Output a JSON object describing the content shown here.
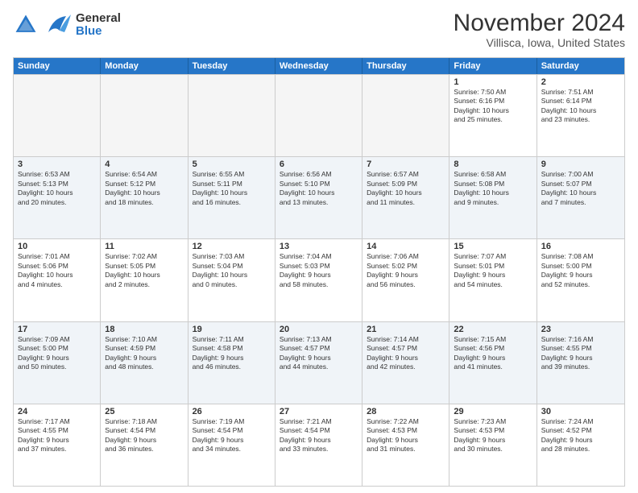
{
  "header": {
    "logo_general": "General",
    "logo_blue": "Blue",
    "month": "November 2024",
    "location": "Villisca, Iowa, United States"
  },
  "days_of_week": [
    "Sunday",
    "Monday",
    "Tuesday",
    "Wednesday",
    "Thursday",
    "Friday",
    "Saturday"
  ],
  "weeks": [
    [
      {
        "day": "",
        "info": "",
        "empty": true
      },
      {
        "day": "",
        "info": "",
        "empty": true
      },
      {
        "day": "",
        "info": "",
        "empty": true
      },
      {
        "day": "",
        "info": "",
        "empty": true
      },
      {
        "day": "",
        "info": "",
        "empty": true
      },
      {
        "day": "1",
        "info": "Sunrise: 7:50 AM\nSunset: 6:16 PM\nDaylight: 10 hours\nand 25 minutes."
      },
      {
        "day": "2",
        "info": "Sunrise: 7:51 AM\nSunset: 6:14 PM\nDaylight: 10 hours\nand 23 minutes."
      }
    ],
    [
      {
        "day": "3",
        "info": "Sunrise: 6:53 AM\nSunset: 5:13 PM\nDaylight: 10 hours\nand 20 minutes."
      },
      {
        "day": "4",
        "info": "Sunrise: 6:54 AM\nSunset: 5:12 PM\nDaylight: 10 hours\nand 18 minutes."
      },
      {
        "day": "5",
        "info": "Sunrise: 6:55 AM\nSunset: 5:11 PM\nDaylight: 10 hours\nand 16 minutes."
      },
      {
        "day": "6",
        "info": "Sunrise: 6:56 AM\nSunset: 5:10 PM\nDaylight: 10 hours\nand 13 minutes."
      },
      {
        "day": "7",
        "info": "Sunrise: 6:57 AM\nSunset: 5:09 PM\nDaylight: 10 hours\nand 11 minutes."
      },
      {
        "day": "8",
        "info": "Sunrise: 6:58 AM\nSunset: 5:08 PM\nDaylight: 10 hours\nand 9 minutes."
      },
      {
        "day": "9",
        "info": "Sunrise: 7:00 AM\nSunset: 5:07 PM\nDaylight: 10 hours\nand 7 minutes."
      }
    ],
    [
      {
        "day": "10",
        "info": "Sunrise: 7:01 AM\nSunset: 5:06 PM\nDaylight: 10 hours\nand 4 minutes."
      },
      {
        "day": "11",
        "info": "Sunrise: 7:02 AM\nSunset: 5:05 PM\nDaylight: 10 hours\nand 2 minutes."
      },
      {
        "day": "12",
        "info": "Sunrise: 7:03 AM\nSunset: 5:04 PM\nDaylight: 10 hours\nand 0 minutes."
      },
      {
        "day": "13",
        "info": "Sunrise: 7:04 AM\nSunset: 5:03 PM\nDaylight: 9 hours\nand 58 minutes."
      },
      {
        "day": "14",
        "info": "Sunrise: 7:06 AM\nSunset: 5:02 PM\nDaylight: 9 hours\nand 56 minutes."
      },
      {
        "day": "15",
        "info": "Sunrise: 7:07 AM\nSunset: 5:01 PM\nDaylight: 9 hours\nand 54 minutes."
      },
      {
        "day": "16",
        "info": "Sunrise: 7:08 AM\nSunset: 5:00 PM\nDaylight: 9 hours\nand 52 minutes."
      }
    ],
    [
      {
        "day": "17",
        "info": "Sunrise: 7:09 AM\nSunset: 5:00 PM\nDaylight: 9 hours\nand 50 minutes."
      },
      {
        "day": "18",
        "info": "Sunrise: 7:10 AM\nSunset: 4:59 PM\nDaylight: 9 hours\nand 48 minutes."
      },
      {
        "day": "19",
        "info": "Sunrise: 7:11 AM\nSunset: 4:58 PM\nDaylight: 9 hours\nand 46 minutes."
      },
      {
        "day": "20",
        "info": "Sunrise: 7:13 AM\nSunset: 4:57 PM\nDaylight: 9 hours\nand 44 minutes."
      },
      {
        "day": "21",
        "info": "Sunrise: 7:14 AM\nSunset: 4:57 PM\nDaylight: 9 hours\nand 42 minutes."
      },
      {
        "day": "22",
        "info": "Sunrise: 7:15 AM\nSunset: 4:56 PM\nDaylight: 9 hours\nand 41 minutes."
      },
      {
        "day": "23",
        "info": "Sunrise: 7:16 AM\nSunset: 4:55 PM\nDaylight: 9 hours\nand 39 minutes."
      }
    ],
    [
      {
        "day": "24",
        "info": "Sunrise: 7:17 AM\nSunset: 4:55 PM\nDaylight: 9 hours\nand 37 minutes."
      },
      {
        "day": "25",
        "info": "Sunrise: 7:18 AM\nSunset: 4:54 PM\nDaylight: 9 hours\nand 36 minutes."
      },
      {
        "day": "26",
        "info": "Sunrise: 7:19 AM\nSunset: 4:54 PM\nDaylight: 9 hours\nand 34 minutes."
      },
      {
        "day": "27",
        "info": "Sunrise: 7:21 AM\nSunset: 4:54 PM\nDaylight: 9 hours\nand 33 minutes."
      },
      {
        "day": "28",
        "info": "Sunrise: 7:22 AM\nSunset: 4:53 PM\nDaylight: 9 hours\nand 31 minutes."
      },
      {
        "day": "29",
        "info": "Sunrise: 7:23 AM\nSunset: 4:53 PM\nDaylight: 9 hours\nand 30 minutes."
      },
      {
        "day": "30",
        "info": "Sunrise: 7:24 AM\nSunset: 4:52 PM\nDaylight: 9 hours\nand 28 minutes."
      }
    ]
  ],
  "alt_rows": [
    1,
    3
  ]
}
